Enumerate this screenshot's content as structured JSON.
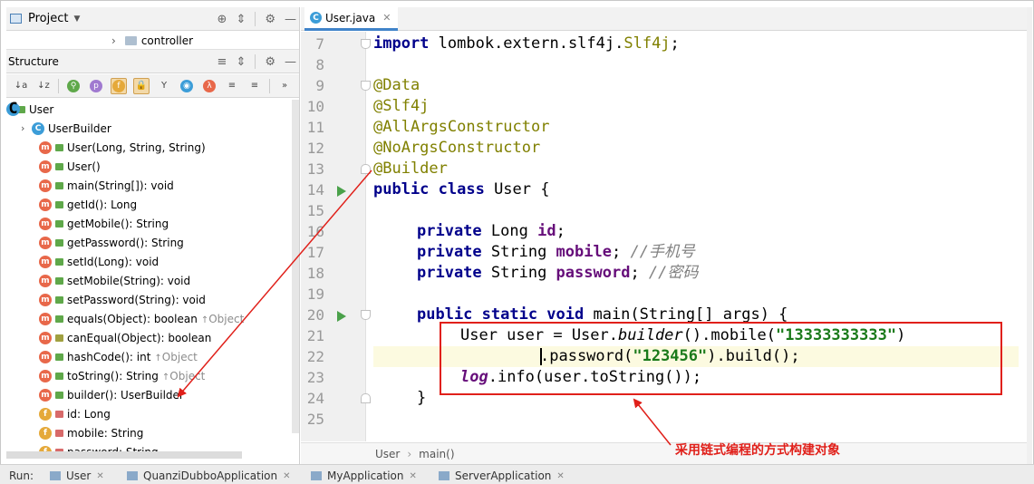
{
  "project_panel": {
    "title": "Project",
    "tree_item": "controller"
  },
  "structure_panel": {
    "title": "Structure",
    "toolbar_glyphs": [
      "↓a",
      "↓z",
      "⚲",
      "p",
      "f",
      "🔒",
      "Y",
      "◉",
      "λ",
      "≡",
      "≡",
      "»"
    ],
    "root": "User",
    "items": [
      {
        "icon": "c",
        "vis": "",
        "label": "UserBuilder",
        "inherited": ""
      },
      {
        "icon": "m",
        "vis": "pub",
        "label": "User(Long, String, String)",
        "inherited": ""
      },
      {
        "icon": "m",
        "vis": "pub",
        "label": "User()",
        "inherited": ""
      },
      {
        "icon": "m",
        "vis": "pub",
        "label": "main(String[]): void",
        "inherited": ""
      },
      {
        "icon": "m",
        "vis": "pub",
        "label": "getId(): Long",
        "inherited": ""
      },
      {
        "icon": "m",
        "vis": "pub",
        "label": "getMobile(): String",
        "inherited": ""
      },
      {
        "icon": "m",
        "vis": "pub",
        "label": "getPassword(): String",
        "inherited": ""
      },
      {
        "icon": "m",
        "vis": "pub",
        "label": "setId(Long): void",
        "inherited": ""
      },
      {
        "icon": "m",
        "vis": "pub",
        "label": "setMobile(String): void",
        "inherited": ""
      },
      {
        "icon": "m",
        "vis": "pub",
        "label": "setPassword(String): void",
        "inherited": ""
      },
      {
        "icon": "m",
        "vis": "pub",
        "label": "equals(Object): boolean",
        "inherited": "Object"
      },
      {
        "icon": "m",
        "vis": "key",
        "label": "canEqual(Object): boolean",
        "inherited": ""
      },
      {
        "icon": "m",
        "vis": "pub",
        "label": "hashCode(): int",
        "inherited": "Object"
      },
      {
        "icon": "m",
        "vis": "pub",
        "label": "toString(): String",
        "inherited": "Object"
      },
      {
        "icon": "m",
        "vis": "pub",
        "label": "builder(): UserBuilder",
        "inherited": ""
      },
      {
        "icon": "f",
        "vis": "lock",
        "label": "id: Long",
        "inherited": ""
      },
      {
        "icon": "f",
        "vis": "lock",
        "label": "mobile: String",
        "inherited": ""
      },
      {
        "icon": "f",
        "vis": "lock",
        "label": "password: String",
        "inherited": ""
      }
    ]
  },
  "editor": {
    "tab": "User.java",
    "line_numbers": [
      "7",
      "8",
      "9",
      "10",
      "11",
      "12",
      "13",
      "14",
      "15",
      "16",
      "17",
      "18",
      "19",
      "20",
      "21",
      "22",
      "23",
      "24",
      "25"
    ],
    "code": {
      "l7_kw": "import",
      "l7_rest": " lombok.extern.slf4j.",
      "l7_cls": "Slf4j",
      "l7_end": ";",
      "l9": "@Data",
      "l10": "@Slf4j",
      "l11": "@AllArgsConstructor",
      "l12": "@NoArgsConstructor",
      "l13": "@Builder",
      "l14_kw": "public class",
      "l14_rest": " User {",
      "l16_kw": "private",
      "l16_type": " Long ",
      "l16_field": "id",
      "l16_end": ";",
      "l17_kw": "private",
      "l17_type": " String ",
      "l17_field": "mobile",
      "l17_end": "; ",
      "l17_comment": "//手机号",
      "l18_kw": "private",
      "l18_type": " String ",
      "l18_field": "password",
      "l18_end": "; ",
      "l18_comment": "//密码",
      "l20_kw": "public static void",
      "l20_rest": " main(String[] args) {",
      "l21_a": "User user = User.",
      "l21_builder": "builder",
      "l21_b": "().mobile(",
      "l21_str": "\"13333333333\"",
      "l21_c": ")",
      "l22_a": ".password(",
      "l22_str": "\"123456\"",
      "l22_b": ").build();",
      "l23_log": "log",
      "l23_rest": ".info(user.toString());",
      "l24": "}"
    },
    "breadcrumb": [
      "User",
      "main()"
    ]
  },
  "run_bar": {
    "label": "Run:",
    "tabs": [
      "User",
      "QuanziDubboApplication",
      "MyApplication",
      "ServerApplication"
    ]
  },
  "annotation": {
    "text": "采用链式编程的方式构建对象",
    "color": "#e0201a"
  }
}
